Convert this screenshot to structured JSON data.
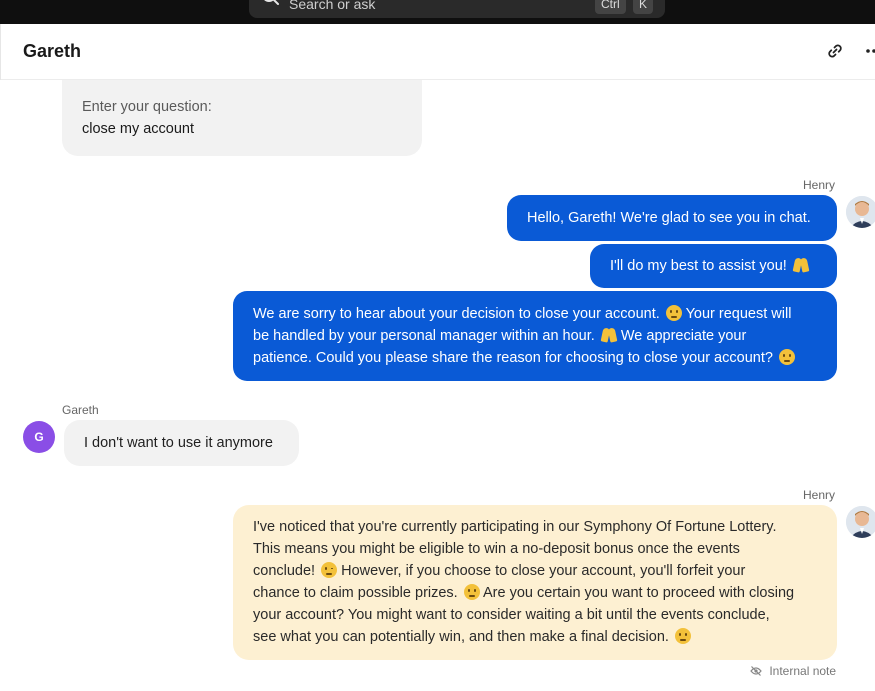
{
  "search": {
    "placeholder": "Search or ask",
    "shortcut_ctrl": "Ctrl",
    "shortcut_key": "K"
  },
  "header": {
    "title": "Gareth"
  },
  "messages": {
    "question": {
      "label": "Enter your question:",
      "value": "close my account"
    },
    "henry_name_1": "Henry",
    "out_1": "Hello, Gareth! We're glad to see you in chat.",
    "out_2": "I'll do my best to assist you!",
    "out_3_line1": "We are sorry to hear about your decision to close your account.",
    "out_3_line1b": "Your request will",
    "out_3_line2": "be handled by your personal manager within an hour.",
    "out_3_line2b": "We appreciate your",
    "out_3_line3": "patience. Could you please share the reason for choosing to close your account?",
    "gareth_name": "Gareth",
    "gareth_initial": "G",
    "in_1": "I don't want to use it anymore",
    "henry_name_2": "Henry",
    "note_lines": [
      "I've noticed that you're currently participating in our Symphony Of Fortune Lottery.",
      "This means you might be eligible to win a no-deposit bonus once the events",
      "conclude!",
      "However, if you choose to close your account, you'll forfeit your",
      "chance to claim possible prizes.",
      "Are you certain you want to proceed with closing",
      "your account? You might want to consider waiting a bit until the events conclude,",
      "see what you can potentially win, and then make a final decision."
    ],
    "internal_note_label": "Internal note"
  },
  "colors": {
    "outgoing": "#0a5ad6",
    "incoming": "#f2f2f2",
    "note": "#fdf0d2",
    "gareth_avatar": "#8a4ee6"
  },
  "icons": {
    "search": "search-icon",
    "link": "link-icon",
    "more": "more-icon",
    "hidden": "eye-off-icon"
  }
}
